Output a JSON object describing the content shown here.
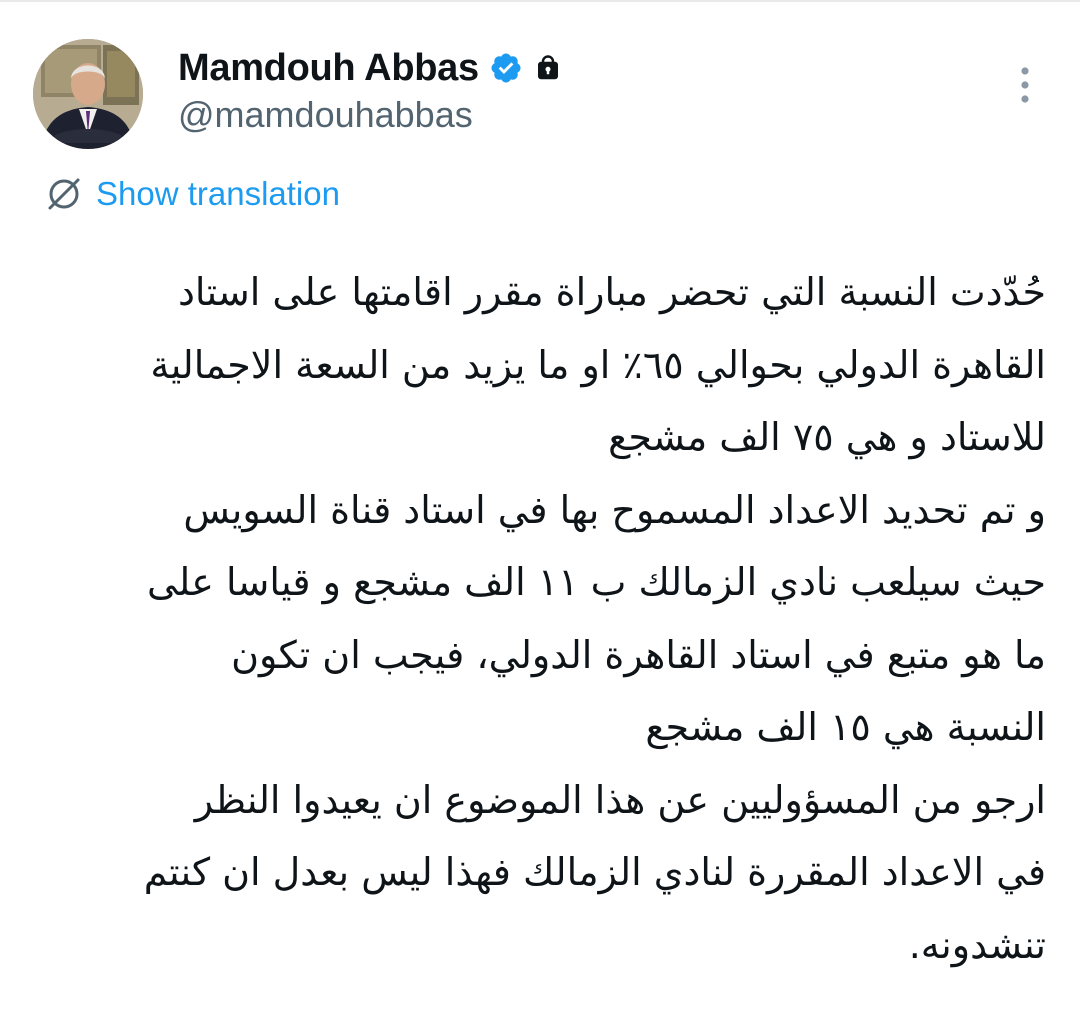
{
  "author": {
    "display_name": "Mamdouh Abbas",
    "handle": "@mamdouhabbas",
    "verified": true,
    "protected": true
  },
  "translation": {
    "label": "Show translation"
  },
  "tweet": {
    "lines": [
      "حُدّدت النسبة التي تحضر مباراة مقرر اقامتها على استاد",
      "القاهرة الدولي بحوالي ٦٥٪ او ما يزيد من السعة الاجمالية",
      "للاستاد و هي ٧٥ الف مشجع",
      "و تم تحديد الاعداد المسموح بها في استاد قناة السويس",
      "حيث سيلعب نادي الزمالك ب ١١ الف مشجع و قياسا على",
      "ما هو متبع في استاد القاهرة الدولي، فيجب ان تكون",
      "النسبة هي ١٥ الف مشجع",
      "ارجو من المسؤوليين عن هذا الموضوع ان يعيدوا النظر",
      "في الاعداد المقررة لنادي الزمالك فهذا ليس بعدل ان كنتم",
      "تنشدونه."
    ]
  },
  "icons": {
    "verified": "verified-badge-icon",
    "lock": "lock-icon",
    "more": "more-vertical-icon",
    "translate": "translate-icon"
  },
  "colors": {
    "accent": "#1d9bf0",
    "text": "#0f1419",
    "secondary": "#536471",
    "menu_dots": "#8b98a5"
  }
}
